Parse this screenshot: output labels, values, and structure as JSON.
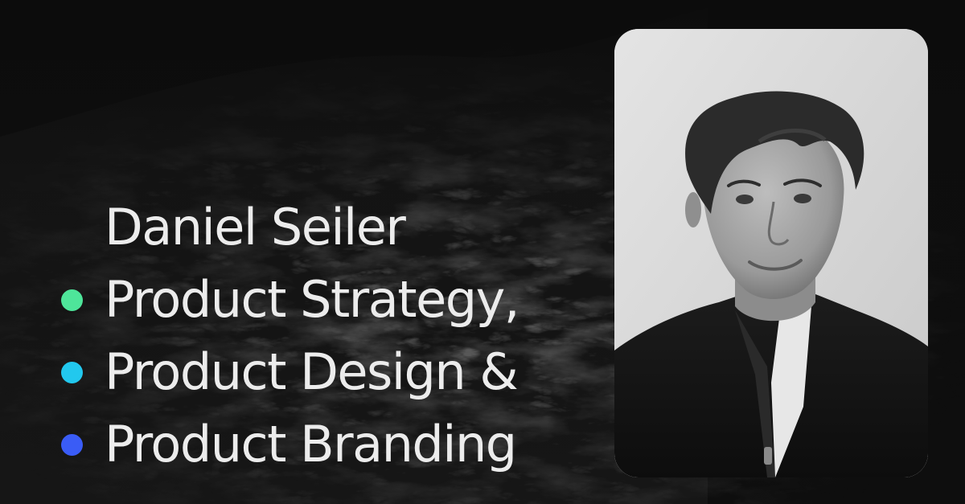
{
  "name": "Daniel Seiler",
  "services": [
    {
      "label": "Product Strategy,",
      "dot_color": "#4ee59a"
    },
    {
      "label": "Product Design &",
      "dot_color": "#22c8ee"
    },
    {
      "label": "Product Branding",
      "dot_color": "#3a5cf6"
    }
  ],
  "colors": {
    "background": "#0e0e0e",
    "text": "#ececec"
  },
  "portrait": {
    "icon": "portrait-photo"
  }
}
